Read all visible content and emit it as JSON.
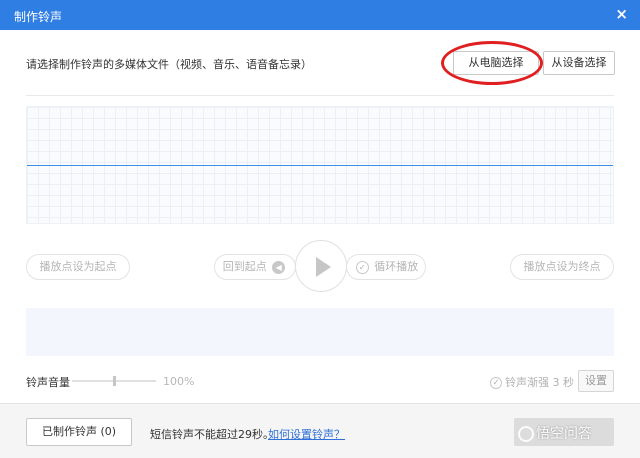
{
  "window": {
    "title": "制作铃声",
    "close_glyph": "×"
  },
  "prompt": "请选择制作铃声的多媒体文件（视频、音乐、语音备忘录）",
  "buttons": {
    "from_pc": "从电脑选择",
    "from_device": "从设备选择"
  },
  "controls": {
    "set_start": "播放点设为起点",
    "back_to_start": "回到起点",
    "loop": "循环播放",
    "set_end": "播放点设为终点"
  },
  "volume": {
    "label": "铃声音量",
    "value": "100%",
    "slider_level": 0.5
  },
  "fade": {
    "label": "铃声渐强 3 秒",
    "settings": "设置"
  },
  "footer": {
    "made_ringtones": "已制作铃声 (0)",
    "notice": "短信铃声不能超过29秒。",
    "help_link": "如何设置铃声？"
  },
  "watermark": "悟空问答",
  "colors": {
    "titlebar": "#2f7ee3",
    "annotation_ring": "#e02020",
    "link": "#2f6fd8",
    "waveform_line": "#3d8ee8"
  },
  "icons": {
    "close": "close-icon",
    "play": "play-icon",
    "back": "rewind-icon",
    "loop": "check-circle-icon",
    "fade": "check-circle-icon"
  }
}
